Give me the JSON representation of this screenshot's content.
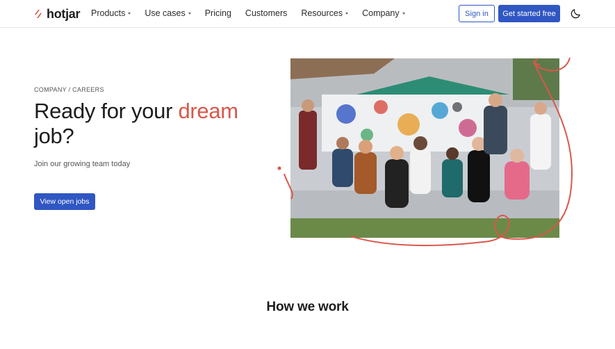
{
  "nav": {
    "brand": "hotjar",
    "items": [
      {
        "label": "Products",
        "dropdown": true
      },
      {
        "label": "Use cases",
        "dropdown": true
      },
      {
        "label": "Pricing",
        "dropdown": false
      },
      {
        "label": "Customers",
        "dropdown": false
      },
      {
        "label": "Resources",
        "dropdown": true
      },
      {
        "label": "Company",
        "dropdown": true
      }
    ],
    "sign_in": "Sign in",
    "get_started": "Get started free",
    "theme_icon": "moon-icon"
  },
  "hero": {
    "breadcrumb": "COMPANY / CAREERS",
    "title_part1": "Ready for your ",
    "title_accent": "dream",
    "title_part2": "job?",
    "subtitle": "Join our growing team today",
    "cta": "View open jobs"
  },
  "section": {
    "title": "How we work"
  },
  "colors": {
    "brand_blue": "#2f56c2",
    "accent_red": "#d9574b",
    "text": "#1d1d1f"
  }
}
